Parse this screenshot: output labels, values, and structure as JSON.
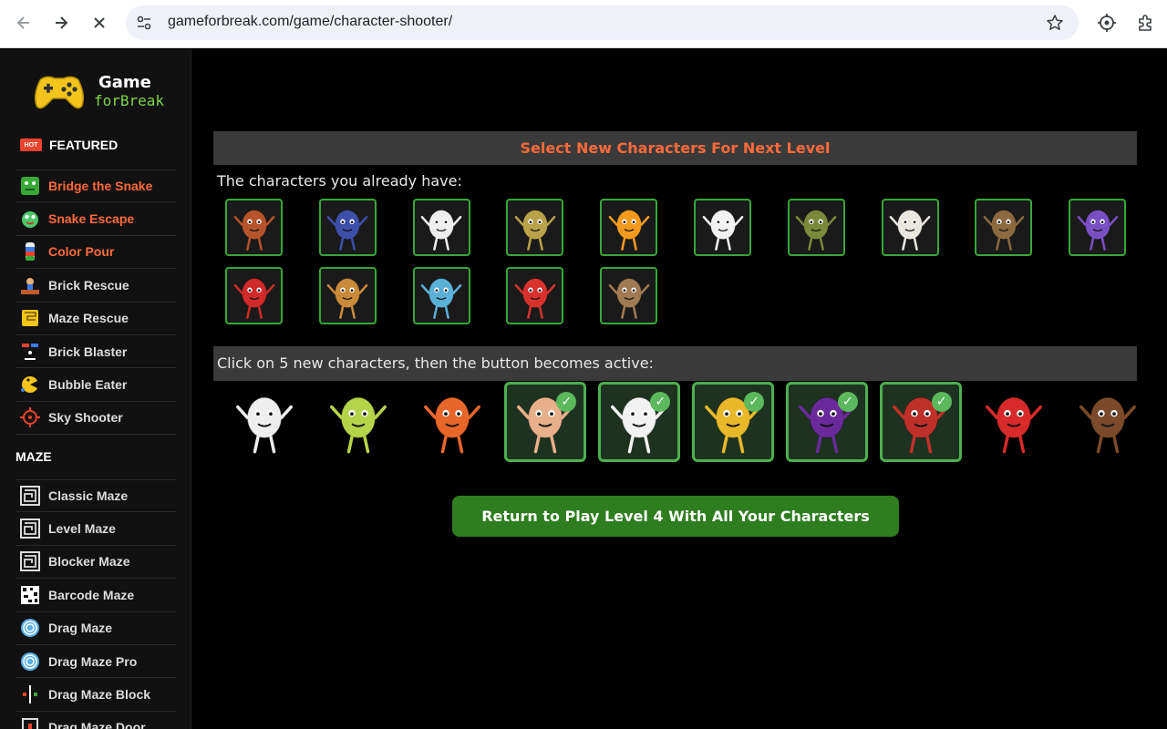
{
  "browser": {
    "url": "gameforbreak.com/game/character-shooter/"
  },
  "logo": {
    "line1": "Game",
    "line2": "forBreak"
  },
  "sidebar": {
    "featured": {
      "badge": "HOT",
      "title": "FEATURED",
      "items": [
        {
          "label": "Bridge the Snake",
          "icon": "snake-face-icon",
          "highlight": true
        },
        {
          "label": "Snake Escape",
          "icon": "snake-head-icon",
          "highlight": true
        },
        {
          "label": "Color Pour",
          "icon": "color-tube-icon",
          "highlight": true
        },
        {
          "label": "Brick Rescue",
          "icon": "brick-rescue-icon",
          "highlight": false
        },
        {
          "label": "Maze Rescue",
          "icon": "maze-rescue-icon",
          "highlight": false
        },
        {
          "label": "Brick Blaster",
          "icon": "brick-blaster-icon",
          "highlight": false
        },
        {
          "label": "Bubble Eater",
          "icon": "bubble-eater-icon",
          "highlight": false
        },
        {
          "label": "Sky Shooter",
          "icon": "crosshair-icon",
          "highlight": false
        }
      ]
    },
    "maze": {
      "title": "MAZE",
      "items": [
        {
          "label": "Classic Maze",
          "icon": "maze-icon"
        },
        {
          "label": "Level Maze",
          "icon": "maze-icon"
        },
        {
          "label": "Blocker Maze",
          "icon": "maze-icon"
        },
        {
          "label": "Barcode Maze",
          "icon": "barcode-icon"
        },
        {
          "label": "Drag Maze",
          "icon": "circle-maze-icon"
        },
        {
          "label": "Drag Maze Pro",
          "icon": "circle-maze-icon"
        },
        {
          "label": "Drag Maze Block",
          "icon": "block-maze-icon"
        },
        {
          "label": "Drag Maze Door",
          "icon": "door-maze-icon"
        }
      ]
    }
  },
  "main": {
    "title": "Select New Characters For Next Level",
    "have_label": "The characters you already have:",
    "click_label": "Click on 5 new characters, then the button becomes active:",
    "button_label": "Return to Play Level 4 With All Your Characters",
    "check_mark": "✓",
    "owned": [
      {
        "name": "red-panda",
        "color": "#b5542a"
      },
      {
        "name": "blueberry",
        "color": "#3d4fa8"
      },
      {
        "name": "turnip",
        "color": "#eeeeee"
      },
      {
        "name": "lizard",
        "color": "#b8a24a"
      },
      {
        "name": "orange",
        "color": "#f29a1e"
      },
      {
        "name": "penguin",
        "color": "#f2f2f2"
      },
      {
        "name": "frog",
        "color": "#7a8a3a"
      },
      {
        "name": "bulldog",
        "color": "#eae6e0"
      },
      {
        "name": "potato",
        "color": "#8a6a3e"
      },
      {
        "name": "duck",
        "color": "#7a4fc4"
      },
      {
        "name": "red-can",
        "color": "#d02a2a"
      },
      {
        "name": "pineapple-bun",
        "color": "#c98a3a"
      },
      {
        "name": "robot",
        "color": "#5bb0d8"
      },
      {
        "name": "red-cup",
        "color": "#d8322e"
      },
      {
        "name": "almond",
        "color": "#a07a52"
      }
    ],
    "candidates": [
      {
        "name": "garlic",
        "color": "#eeeeee",
        "selected": false
      },
      {
        "name": "melon",
        "color": "#b5d44a",
        "selected": false
      },
      {
        "name": "carrot",
        "color": "#e8662a",
        "selected": false
      },
      {
        "name": "ice-pop",
        "color": "#e8b08a",
        "selected": true
      },
      {
        "name": "cauliflower",
        "color": "#f2f2f2",
        "selected": true
      },
      {
        "name": "corn",
        "color": "#e8b82a",
        "selected": true
      },
      {
        "name": "eggplant",
        "color": "#6a2a9a",
        "selected": true
      },
      {
        "name": "meat-block",
        "color": "#c0302a",
        "selected": true
      },
      {
        "name": "popcorn",
        "color": "#d82a2a",
        "selected": false
      },
      {
        "name": "monkey",
        "color": "#7a4a2a",
        "selected": false
      }
    ]
  }
}
